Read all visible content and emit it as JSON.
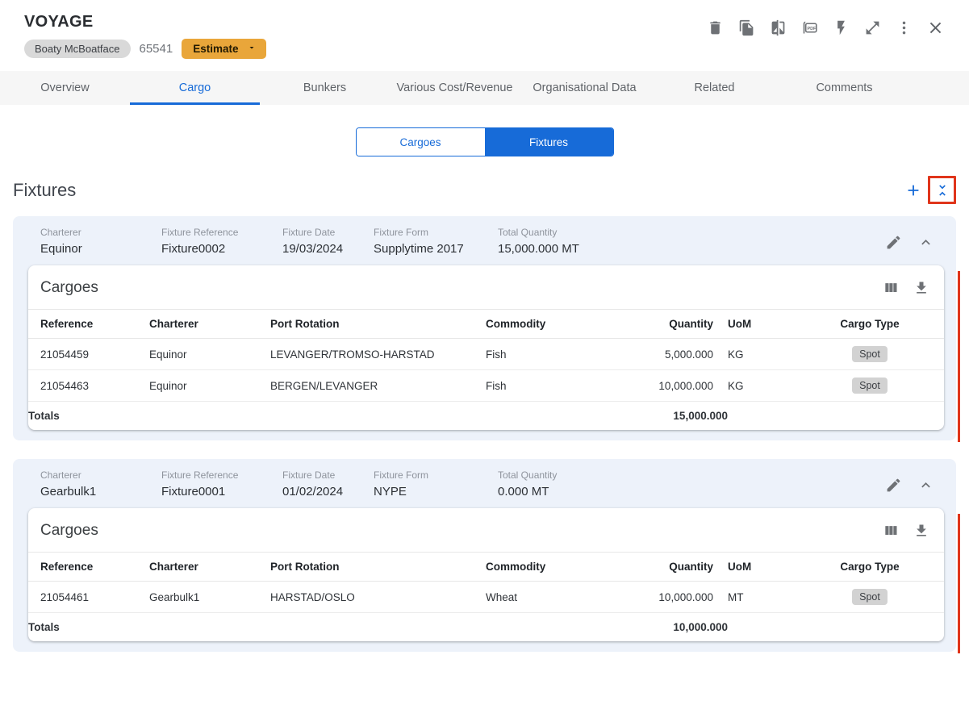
{
  "colors": {
    "accent_blue": "#176bd8",
    "estimate_amber": "#e9a63a",
    "error_red": "#e0351b",
    "card_header_bg": "#edf2fa",
    "chip_gray": "#d9d9d9"
  },
  "window": {
    "title": "VOYAGE",
    "vessel_chip": "Boaty McBoatface",
    "voyage_number": "65541",
    "estimate_button": "Estimate",
    "toolbar_icons": [
      "delete",
      "copy",
      "compare",
      "pdf-export",
      "flash",
      "expand",
      "more",
      "close"
    ]
  },
  "tabs": [
    {
      "label": "Overview"
    },
    {
      "label": "Cargo",
      "active": true
    },
    {
      "label": "Bunkers"
    },
    {
      "label": "Various Cost/Revenue"
    },
    {
      "label": "Organisational Data"
    },
    {
      "label": "Related"
    },
    {
      "label": "Comments"
    }
  ],
  "view_toggle": {
    "cargoes_label": "Cargoes",
    "fixtures_label": "Fixtures",
    "selected": "Fixtures"
  },
  "fixtures_section": {
    "title": "Fixtures",
    "actions": [
      "add-fixture",
      "collapse-all"
    ]
  },
  "fixtures": [
    {
      "charterer": {
        "label": "Charterer",
        "value": "Equinor"
      },
      "fixture_reference": {
        "label": "Fixture Reference",
        "value": "Fixture0002"
      },
      "fixture_date": {
        "label": "Fixture Date",
        "value": "19/03/2024"
      },
      "fixture_form": {
        "label": "Fixture Form",
        "value": "Supplytime 2017"
      },
      "total_quantity": {
        "label": "Total Quantity",
        "value": "15,000.000 MT"
      },
      "cargoes": {
        "title": "Cargoes",
        "columns": [
          "Reference",
          "Charterer",
          "Port Rotation",
          "Commodity",
          "Quantity",
          "UoM",
          "Cargo Type"
        ],
        "rows": [
          {
            "reference": "21054459",
            "charterer": "Equinor",
            "port_rotation": "LEVANGER/TROMSO-HARSTAD",
            "commodity": "Fish",
            "quantity": "5,000.000",
            "uom": "KG",
            "cargo_type": "Spot"
          },
          {
            "reference": "21054463",
            "charterer": "Equinor",
            "port_rotation": "BERGEN/LEVANGER",
            "commodity": "Fish",
            "quantity": "10,000.000",
            "uom": "KG",
            "cargo_type": "Spot"
          }
        ],
        "totals": {
          "label": "Totals",
          "quantity": "15,000.000"
        }
      }
    },
    {
      "charterer": {
        "label": "Charterer",
        "value": "Gearbulk1"
      },
      "fixture_reference": {
        "label": "Fixture Reference",
        "value": "Fixture0001"
      },
      "fixture_date": {
        "label": "Fixture Date",
        "value": "01/02/2024"
      },
      "fixture_form": {
        "label": "Fixture Form",
        "value": "NYPE"
      },
      "total_quantity": {
        "label": "Total Quantity",
        "value": "0.000 MT"
      },
      "cargoes": {
        "title": "Cargoes",
        "columns": [
          "Reference",
          "Charterer",
          "Port Rotation",
          "Commodity",
          "Quantity",
          "UoM",
          "Cargo Type"
        ],
        "rows": [
          {
            "reference": "21054461",
            "charterer": "Gearbulk1",
            "port_rotation": "HARSTAD/OSLO",
            "commodity": "Wheat",
            "quantity": "10,000.000",
            "uom": "MT",
            "cargo_type": "Spot"
          }
        ],
        "totals": {
          "label": "Totals",
          "quantity": "10,000.000"
        }
      }
    }
  ]
}
